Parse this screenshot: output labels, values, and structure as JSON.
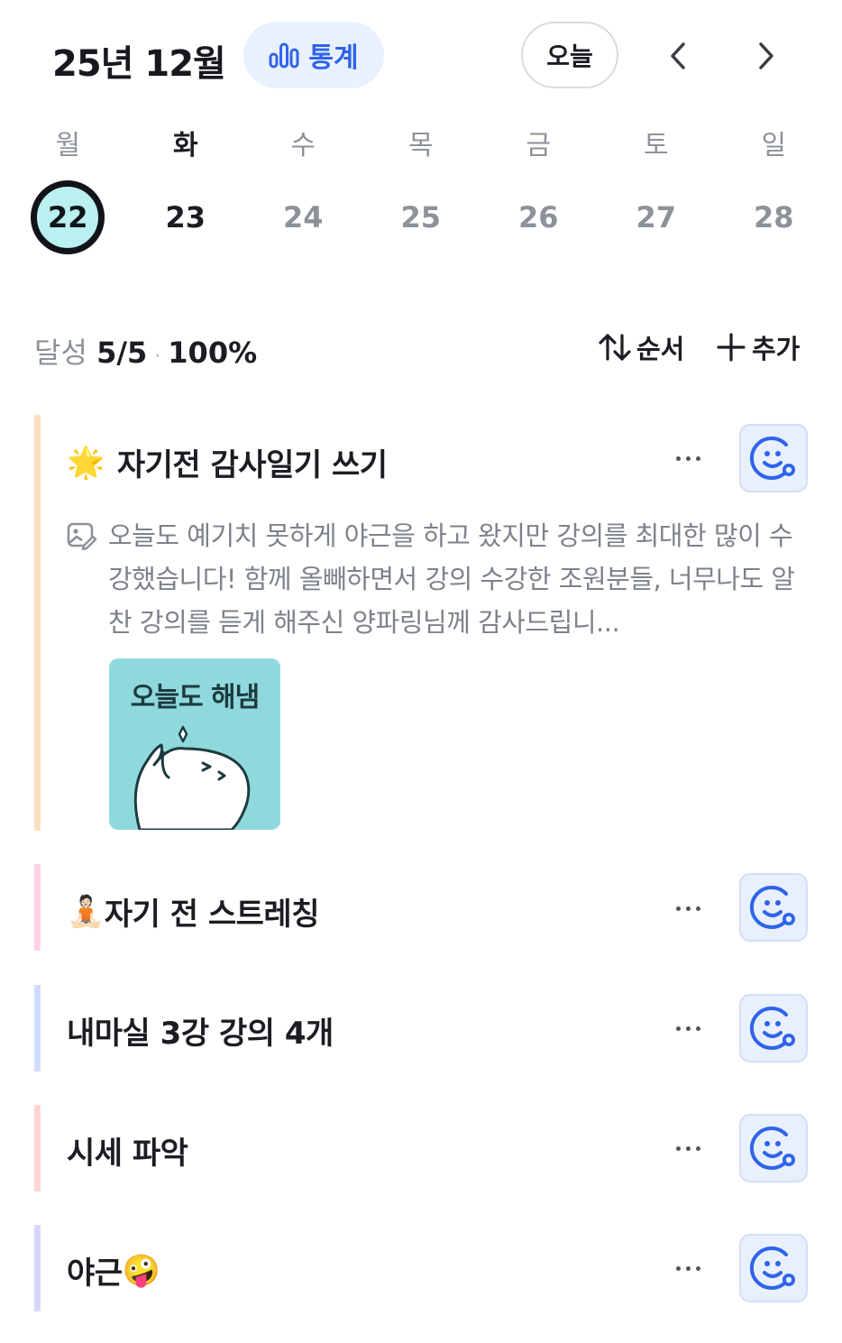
{
  "header": {
    "month_title": "25년 12월",
    "stats_label": "통계",
    "today_label": "오늘",
    "prev_icon": "chevron-left-icon",
    "next_icon": "chevron-right-icon"
  },
  "week": {
    "weekdays": [
      "월",
      "화",
      "수",
      "목",
      "금",
      "토",
      "일"
    ],
    "dates": [
      "22",
      "23",
      "24",
      "25",
      "26",
      "27",
      "28"
    ],
    "selected_index": 0,
    "current_index": 1
  },
  "summary": {
    "label": "달성",
    "count": "5/5",
    "separator": "·",
    "percent": "100%",
    "order_label": "순서",
    "add_label": "추가"
  },
  "tasks": [
    {
      "emoji": "🌟",
      "title": "자기전 감사일기 쓰기",
      "bar_color": "#fbe0bf",
      "memo": "오늘도 예기치 못하게 야근을 하고 왔지만 강의를 최대한 많이 수강했습니다! 함께 올빼하면서 강의 수강한 조원분들, 너무나도 알찬 강의를 듣게 해주신 양파링님께 감사드립니...",
      "sticker_text": "오늘도 해냄"
    },
    {
      "emoji": "🧘🏻",
      "title": "자기 전 스트레칭",
      "bar_color": "#fbd2e6"
    },
    {
      "emoji": "",
      "title": "내마실 3강 강의 4개",
      "bar_color": "#cfdcfb"
    },
    {
      "emoji": "",
      "title": "시세 파악",
      "bar_color": "#fcd5d5"
    },
    {
      "emoji": "🤪",
      "title": "야근",
      "bar_color": "#d8d6fb"
    }
  ],
  "colors": {
    "accent": "#2f64ea",
    "selected_fill": "#baf0f0",
    "muted_text": "#8d9299"
  }
}
